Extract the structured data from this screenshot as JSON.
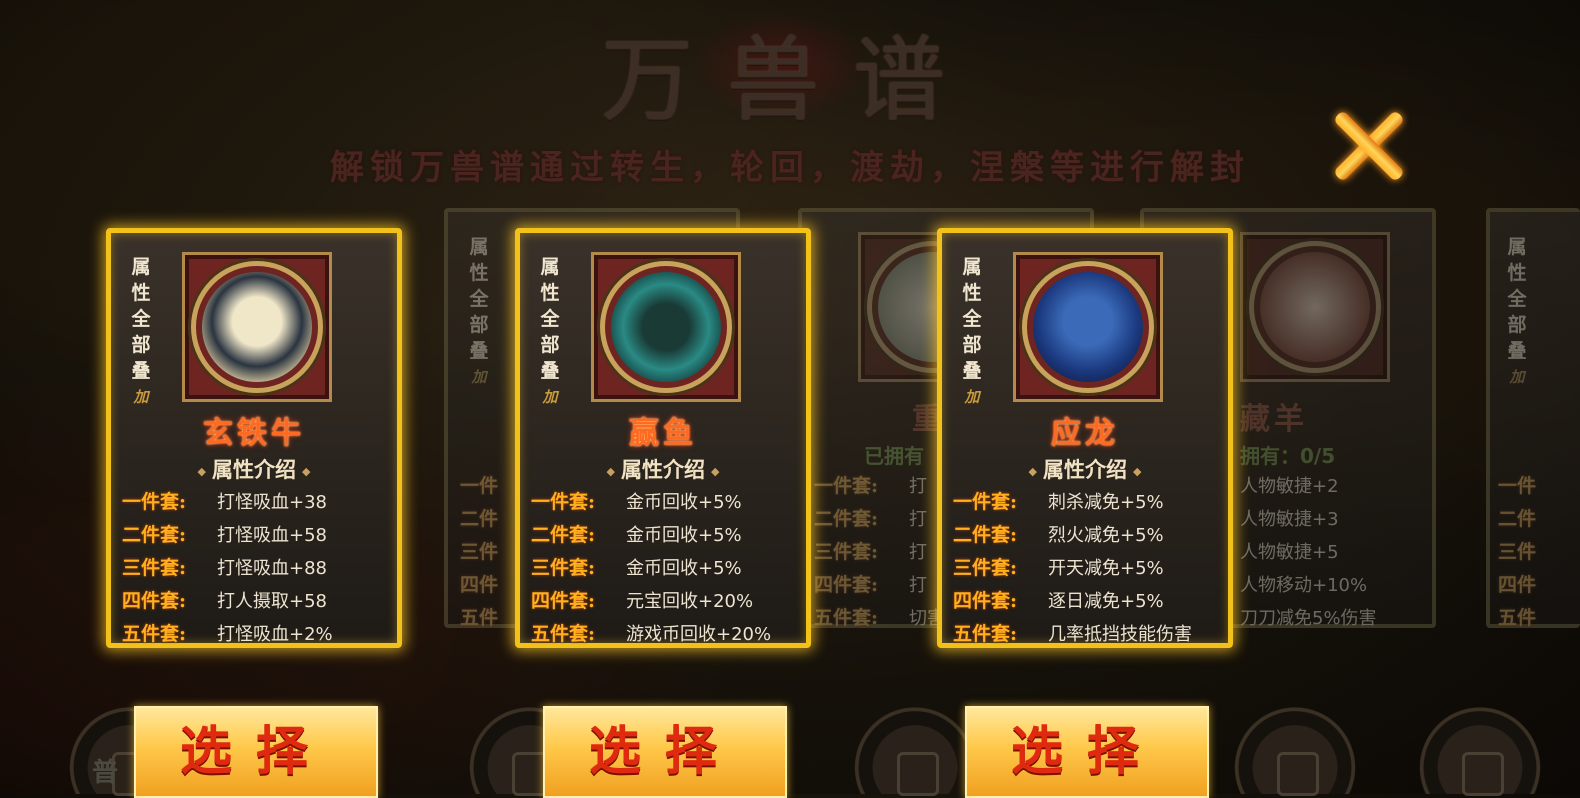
{
  "title": "万兽谱",
  "subtitle": "解锁万兽谱通过转生，轮回，渡劫，涅槃等进行解封",
  "vertical_label": [
    "属",
    "性",
    "全",
    "部",
    "叠",
    "加"
  ],
  "attr_intro": "属性介绍",
  "select_label": "选择",
  "bottom_left_text": "普",
  "colors": {
    "gold_frame": "#f2c21a",
    "set_label": "#ffb01e",
    "name": "#ff6a22",
    "owned": "#5fae2a"
  },
  "cards": [
    {
      "name": "玄铁牛",
      "set_labels": [
        "一件套:",
        "二件套:",
        "三件套:",
        "四件套:",
        "五件套:"
      ],
      "sets": [
        "打怪吸血+38",
        "打怪吸血+58",
        "打怪吸血+88",
        "打人摄取+58",
        "打怪吸血+2%"
      ]
    },
    {
      "name": "",
      "set_labels": [
        "一件",
        "二件",
        "三件",
        "四件",
        "五件"
      ],
      "sets": [
        "",
        "",
        "",
        "",
        ""
      ]
    },
    {
      "name": "赢鱼",
      "set_labels": [
        "一件套:",
        "二件套:",
        "三件套:",
        "四件套:",
        "五件套:"
      ],
      "sets": [
        "金币回收+5%",
        "金币回收+5%",
        "金币回收+5%",
        "元宝回收+20%",
        "游戏币回收+20%"
      ]
    },
    {
      "name": "重明",
      "owned": "已拥有",
      "set_labels": [
        "一件套:",
        "二件套:",
        "三件套:",
        "四件套:",
        "五件套:"
      ],
      "sets": [
        "打",
        "打",
        "打",
        "打",
        "切害"
      ]
    },
    {
      "name": "应龙",
      "set_labels": [
        "一件套:",
        "二件套:",
        "三件套:",
        "四件套:",
        "五件套:"
      ],
      "sets": [
        "刺杀减免+5%",
        "烈火减免+5%",
        "开天减免+5%",
        "逐日减免+5%",
        "几率抵挡技能伤害"
      ]
    },
    {
      "name": "藏羊",
      "owned": "拥有：0/5",
      "sets": [
        "人物敏捷+2",
        "人物敏捷+3",
        "人物敏捷+5",
        "人物移动+10%",
        "刀刀减免5%伤害"
      ]
    },
    {
      "name": "",
      "set_labels": [
        "一件",
        "二件",
        "三件",
        "四件",
        "五件"
      ],
      "sets": [
        "",
        "",
        "",
        "",
        ""
      ]
    }
  ]
}
